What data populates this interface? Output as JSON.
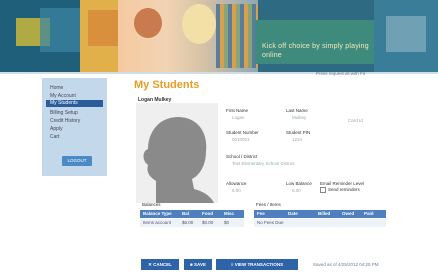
{
  "banner": {
    "tagline": "Kick off choice by simply playing online"
  },
  "header_link": "Press request all with Fit",
  "sidebar": {
    "items": [
      {
        "label": "Home"
      },
      {
        "label": "My Account"
      },
      {
        "label": "My Students"
      },
      {
        "label": "Billing Setup"
      },
      {
        "label": "Credit History"
      },
      {
        "label": "Apply"
      },
      {
        "label": "Cart"
      }
    ],
    "active_index": 2,
    "logout_label": "LOGOUT"
  },
  "page": {
    "title": "My Students",
    "student_name": "Logan Mulkey"
  },
  "form": {
    "first_name_label": "First Name",
    "first_name_value": "Logan",
    "last_name_label": "Last Name",
    "last_name_value": "Mulkey",
    "student_number_label": "Student Number",
    "student_number_value": "0010001",
    "student_pin_label": "Student PIN",
    "student_pin_value": "1234",
    "school_district_label": "School / District",
    "school_district_value": "Test Elementary School District",
    "extra_value": "Card Id",
    "allowance_label": "Allowance",
    "allowance_value": "5.00",
    "low_balance_label": "Low Balance",
    "low_balance_value": "5.00",
    "email_reminder_label": "Email Reminder Level",
    "email_reminder_option": "Send reminders"
  },
  "balances": {
    "title": "Balances",
    "columns": [
      "Balance Type",
      "Bal",
      "Food",
      "Misc"
    ],
    "rows": [
      [
        "Items account",
        "$6.00",
        "$0.00",
        "$0"
      ]
    ]
  },
  "fees": {
    "title": "Fees / Items",
    "columns": [
      "Fee",
      "Date",
      "Billed",
      "Owed",
      "Paid"
    ],
    "rows": [
      [
        "No Fees Due",
        "",
        "",
        "",
        ""
      ]
    ]
  },
  "buttons": {
    "cancel": "CANCEL",
    "save": "SAVE",
    "view_transactions": "VIEW TRANSACTIONS"
  },
  "footer_note": "Saved as of 4/25/2012 04:25 PM"
}
